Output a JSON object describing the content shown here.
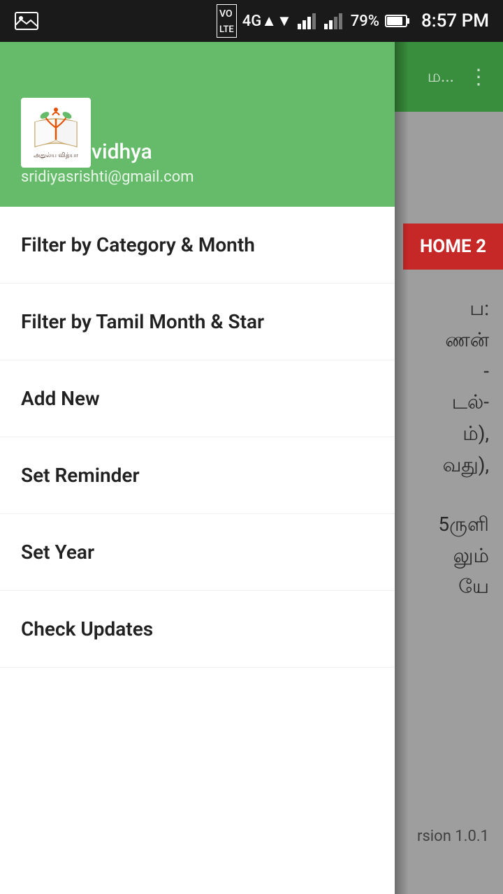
{
  "statusBar": {
    "time": "8:57 PM",
    "battery": "79%",
    "signals": "VO LTE 4G"
  },
  "background": {
    "appBarText": "ம...",
    "home2Label": "HOME 2",
    "tamilLine1": "ப:",
    "tamilLine2": "ணன்",
    "tamilLine3": "-",
    "tamilLine4": "டல்-",
    "tamilLine5": "ம்),",
    "tamilLine6": "வது),",
    "tamilLine7": "5ருளி",
    "tamilLine8": "லும்",
    "tamilLine9": "யே",
    "versionText": "rsion 1.0.1"
  },
  "drawer": {
    "logoAlt": "Athulyavidhya Logo",
    "userName": "Athulyavidhya",
    "userEmail": "sridiyasrishti@gmail.com",
    "menuItems": [
      {
        "id": "filter-category",
        "label": "Filter by Category & Month"
      },
      {
        "id": "filter-tamil",
        "label": "Filter by Tamil Month & Star"
      },
      {
        "id": "add-new",
        "label": "Add New"
      },
      {
        "id": "set-reminder",
        "label": "Set Reminder"
      },
      {
        "id": "set-year",
        "label": "Set Year"
      },
      {
        "id": "check-updates",
        "label": "Check Updates"
      }
    ]
  }
}
